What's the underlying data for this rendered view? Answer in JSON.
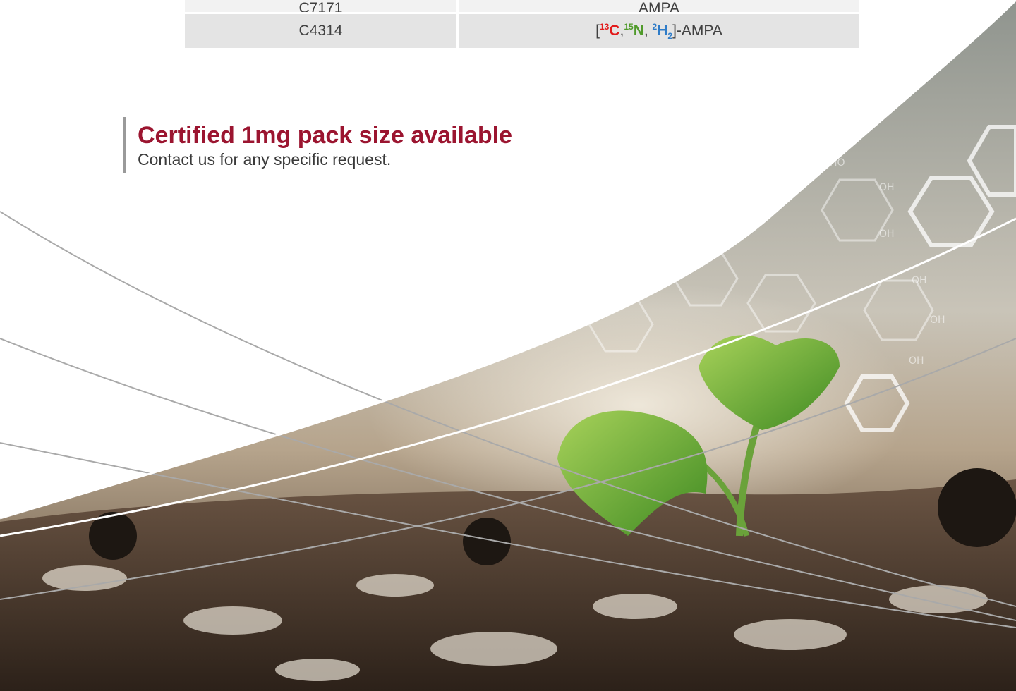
{
  "table": {
    "rows": [
      {
        "code": "C7171",
        "compound": "AMPA"
      },
      {
        "code": "C4314",
        "compound_parts": {
          "open": "[",
          "c_mass": "13",
          "c_symbol": "C",
          "sep1": ",",
          "n_mass": "15",
          "n_symbol": "N",
          "sep2": ", ",
          "h_mass": "2",
          "h_symbol": "H",
          "h_count": "2",
          "close": "]-AMPA"
        }
      }
    ]
  },
  "callout": {
    "title": "Certified 1mg pack size available",
    "text": "Contact us for any specific request."
  },
  "colors": {
    "brand_red": "#9b1530",
    "isotope_carbon": "#e21b1b",
    "isotope_nitrogen": "#4f9a2a",
    "isotope_hydrogen": "#2f7cc8"
  },
  "image": {
    "subject": "seedling-in-soil-with-molecular-structures"
  }
}
